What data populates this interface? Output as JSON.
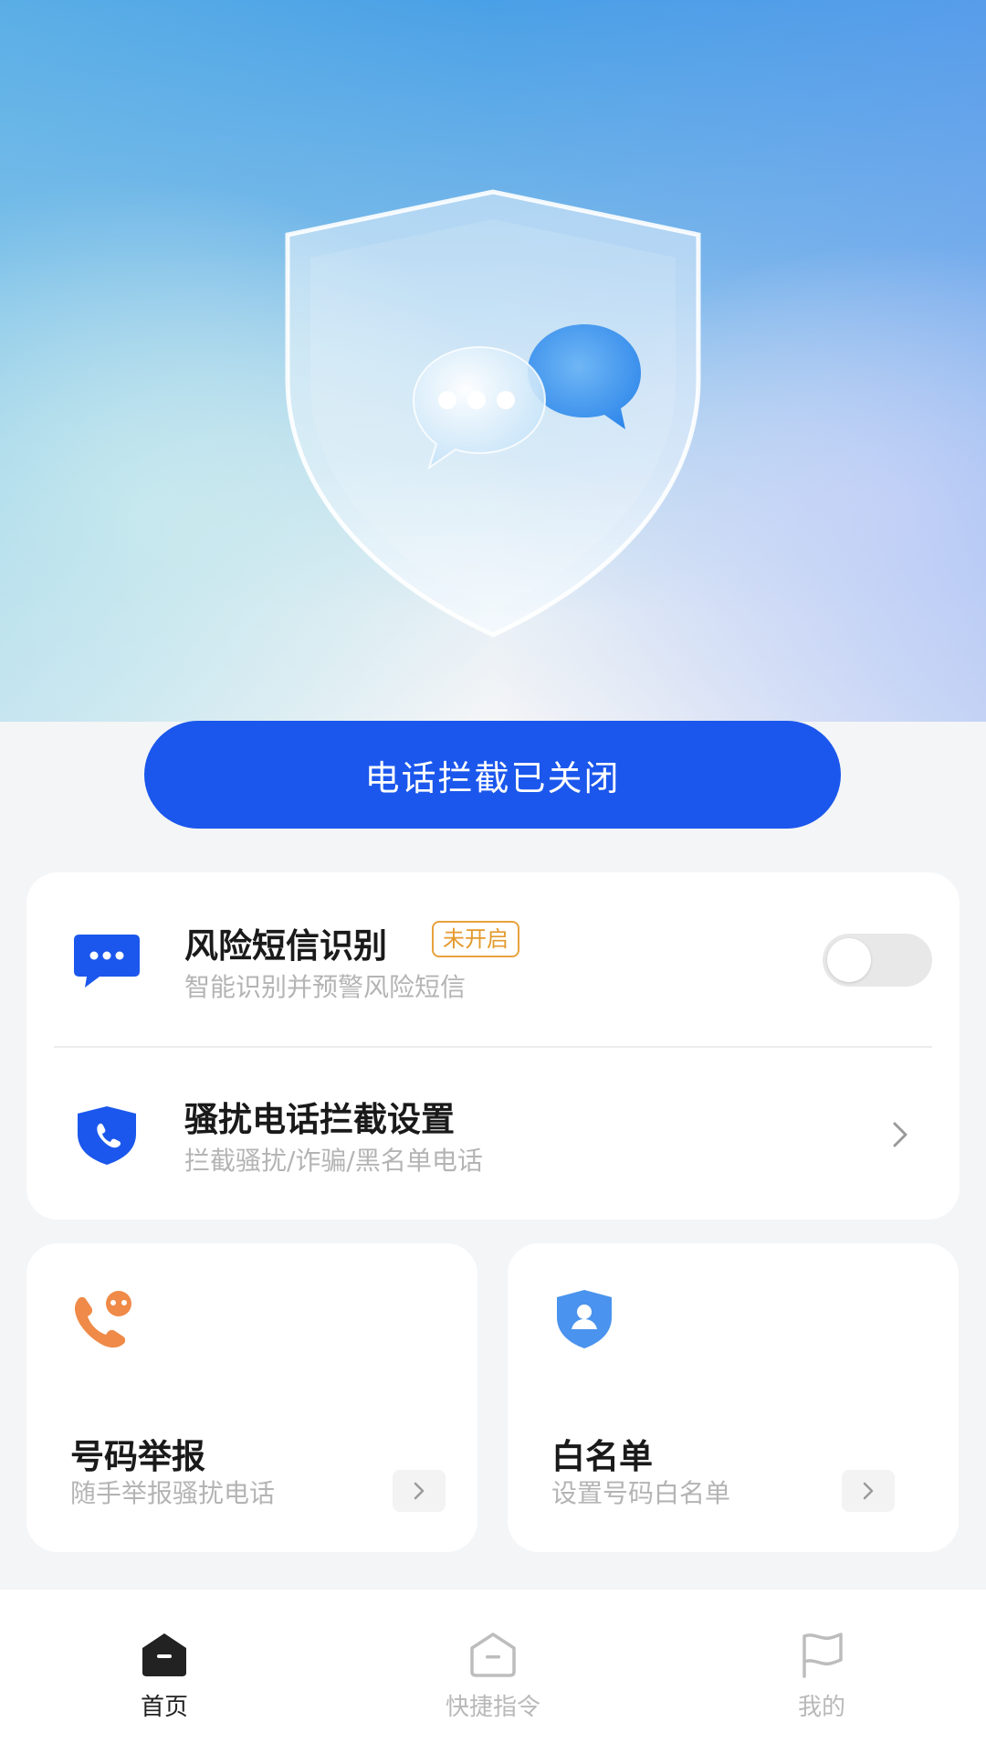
{
  "main_button": {
    "label": "电话拦截已关闭"
  },
  "sms_risk": {
    "title": "风险短信识别",
    "badge": "未开启",
    "subtitle": "智能识别并预警风险短信",
    "toggle_on": false
  },
  "call_block": {
    "title": "骚扰电话拦截设置",
    "subtitle": "拦截骚扰/诈骗/黑名单电话"
  },
  "report": {
    "title": "号码举报",
    "subtitle": "随手举报骚扰电话"
  },
  "whitelist": {
    "title": "白名单",
    "subtitle": "设置号码白名单"
  },
  "tabs": [
    {
      "label": "首页",
      "icon": "home-icon",
      "active": true
    },
    {
      "label": "快捷指令",
      "icon": "shortcut-icon",
      "active": false
    },
    {
      "label": "我的",
      "icon": "flag-icon",
      "active": false
    }
  ],
  "colors": {
    "primary": "#1b57ec",
    "badge": "#e49a2c",
    "report_icon": "#ef8a48",
    "whitelist_icon": "#4a93ee"
  }
}
